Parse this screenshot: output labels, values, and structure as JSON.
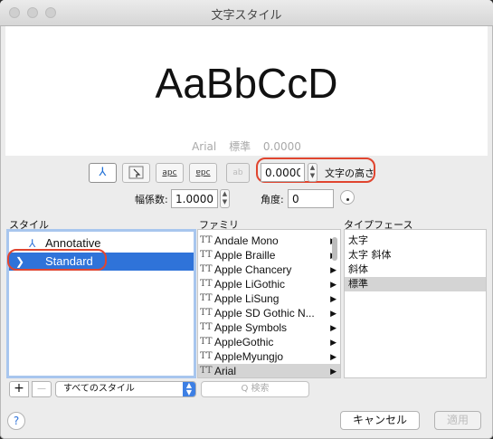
{
  "window": {
    "title": "文字スタイル"
  },
  "preview": {
    "sample": "AaBbCcD",
    "font": "Arial",
    "style": "標準",
    "height": "0.0000"
  },
  "toolbar": {
    "annotative_icon": "annotative-icon",
    "upside_down_text": "apc",
    "backwards_text": "ɐpc",
    "vertical_text": "ab",
    "text_height_value": "0.0000",
    "text_height_label": "文字の高さ",
    "width_factor_label": "幅係数:",
    "width_factor_value": "1.0000",
    "oblique_angle_label": "角度:",
    "oblique_angle_value": "0"
  },
  "styles": {
    "header": "スタイル",
    "items": [
      {
        "label": "Annotative",
        "icon": "annotative-icon",
        "selected": false
      },
      {
        "label": "Standard",
        "icon": "chevron-right-icon",
        "selected": true
      }
    ]
  },
  "family": {
    "header": "ファミリ",
    "items": [
      {
        "label": "Andale Mono",
        "selected": false
      },
      {
        "label": "Apple Braille",
        "selected": false
      },
      {
        "label": "Apple Chancery",
        "selected": false
      },
      {
        "label": "Apple LiGothic",
        "selected": false
      },
      {
        "label": "Apple LiSung",
        "selected": false
      },
      {
        "label": "Apple SD Gothic N...",
        "selected": false
      },
      {
        "label": "Apple Symbols",
        "selected": false
      },
      {
        "label": "AppleGothic",
        "selected": false
      },
      {
        "label": "AppleMyungjo",
        "selected": false
      },
      {
        "label": "Arial",
        "selected": true
      }
    ]
  },
  "typeface": {
    "header": "タイプフェース",
    "items": [
      {
        "label": "太字",
        "selected": false
      },
      {
        "label": "太字 斜体",
        "selected": false
      },
      {
        "label": "斜体",
        "selected": false
      },
      {
        "label": "標準",
        "selected": true
      }
    ]
  },
  "bottom": {
    "add": "+",
    "remove": "—",
    "filter_value": "すべてのスタイル",
    "search_placeholder": "Q 検索",
    "help": "?",
    "cancel": "キャンセル",
    "apply": "適用"
  },
  "colors": {
    "accent": "#2f73d9",
    "highlight": "#e0452f"
  }
}
